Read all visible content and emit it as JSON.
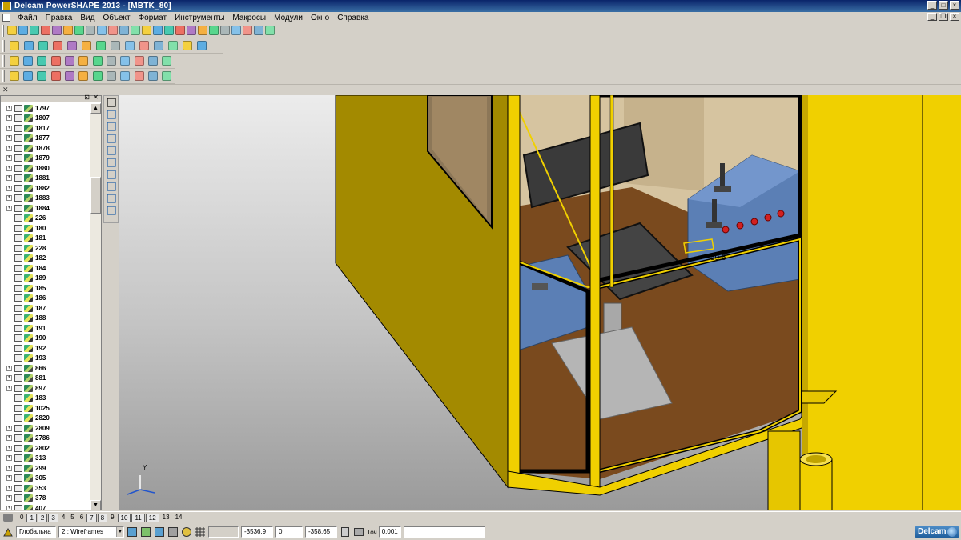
{
  "window": {
    "title": "Delcam PowerSHAPE 2013 - [MBTK_80]"
  },
  "menu": [
    "Файл",
    "Правка",
    "Вид",
    "Объект",
    "Формат",
    "Инструменты",
    "Макросы",
    "Модули",
    "Окно",
    "Справка"
  ],
  "toolbar_icons": {
    "row1": [
      "new-file-icon",
      "open-file-icon",
      "open-model-icon",
      "save-icon",
      "print-icon",
      "print-preview-icon",
      "cut-icon",
      "copy-icon",
      "paste-icon",
      "brush-icon",
      "delete-icon",
      "undo-icon",
      "redo-icon",
      "zoom-select-icon",
      "quick-select-icon",
      "workplane-icon",
      "select-icon",
      "circle-icon",
      "curve-icon",
      "text-icon",
      "paint-icon",
      "shade-icon",
      "render-icon",
      "wireframe-icon"
    ],
    "row2": [
      "view-top-icon",
      "view-front-icon",
      "view-side-icon",
      "view-iso-icon",
      "view-iso2-icon",
      "zoom-in-icon",
      "zoom-out-icon",
      "zoom-window-icon",
      "zoom-fit-icon",
      "rotate-icon",
      "shaded-icon",
      "shaded-wire-icon",
      "lighting-icon",
      "render-mode-icon"
    ],
    "row3": [
      "model-icon",
      "document-icon",
      "fill-icon",
      "surface-icon",
      "solid-sphere-icon",
      "cone-icon",
      "wedge-icon",
      "box-icon",
      "box2-icon",
      "extrude-icon",
      "revolve-icon",
      "blend-icon"
    ],
    "row4": [
      "sphere-icon",
      "trim-icon",
      "feature-icon",
      "solid-icon",
      "cut-solid-icon",
      "shell-icon",
      "fillet-icon",
      "chamfer-icon",
      "pattern-icon",
      "mirror-icon",
      "boolean-icon",
      "draft-icon"
    ]
  },
  "tree": {
    "items": [
      {
        "label": "1797",
        "expandable": true
      },
      {
        "label": "1807",
        "expandable": true
      },
      {
        "label": "1817",
        "expandable": true
      },
      {
        "label": "1877",
        "expandable": true
      },
      {
        "label": "1878",
        "expandable": true
      },
      {
        "label": "1879",
        "expandable": true
      },
      {
        "label": "1880",
        "expandable": true
      },
      {
        "label": "1881",
        "expandable": true
      },
      {
        "label": "1882",
        "expandable": true
      },
      {
        "label": "1883",
        "expandable": true
      },
      {
        "label": "1884",
        "expandable": true
      },
      {
        "label": "226",
        "expandable": false
      },
      {
        "label": "180",
        "expandable": false
      },
      {
        "label": "181",
        "expandable": false
      },
      {
        "label": "228",
        "expandable": false
      },
      {
        "label": "182",
        "expandable": false
      },
      {
        "label": "184",
        "expandable": false
      },
      {
        "label": "189",
        "expandable": false
      },
      {
        "label": "185",
        "expandable": false
      },
      {
        "label": "186",
        "expandable": false
      },
      {
        "label": "187",
        "expandable": false
      },
      {
        "label": "188",
        "expandable": false
      },
      {
        "label": "191",
        "expandable": false
      },
      {
        "label": "190",
        "expandable": false
      },
      {
        "label": "192",
        "expandable": false
      },
      {
        "label": "193",
        "expandable": false
      },
      {
        "label": "866",
        "expandable": true
      },
      {
        "label": "881",
        "expandable": true
      },
      {
        "label": "897",
        "expandable": true
      },
      {
        "label": "183",
        "expandable": false
      },
      {
        "label": "1025",
        "expandable": false
      },
      {
        "label": "2820",
        "expandable": false
      },
      {
        "label": "2809",
        "expandable": true
      },
      {
        "label": "2786",
        "expandable": true
      },
      {
        "label": "2802",
        "expandable": true
      },
      {
        "label": "313",
        "expandable": true
      },
      {
        "label": "299",
        "expandable": true
      },
      {
        "label": "305",
        "expandable": true
      },
      {
        "label": "353",
        "expandable": true
      },
      {
        "label": "378",
        "expandable": true
      },
      {
        "label": "407",
        "expandable": true
      }
    ]
  },
  "viewport": {
    "dimension_label": "59.5",
    "axis_y_label": "Y"
  },
  "levels": [
    "0",
    "1",
    "2",
    "3",
    "4",
    "5",
    "6",
    "7",
    "8",
    "9",
    "10",
    "11",
    "12",
    "13",
    "14"
  ],
  "levels_boxed": [
    "1",
    "2",
    "3",
    "7",
    "8",
    "10",
    "11",
    "12"
  ],
  "status": {
    "workplane": "Глобальна",
    "view_number": "2",
    "view_mode": ": Wireframes",
    "x": "-3536.9",
    "y": "0",
    "z": "-358.65",
    "tolerance_label": "Точ",
    "tolerance_value": "0.001",
    "brand": "Delcam"
  },
  "colors": {
    "title_bar": "#0a246a",
    "cabin_yellow": "#f0d000",
    "cabin_dark_yellow": "#a08800",
    "floor_brown": "#7a4a1e",
    "console_blue": "#5b7fb5",
    "seat_dark": "#3a3a3a",
    "button_red": "#d22020"
  }
}
